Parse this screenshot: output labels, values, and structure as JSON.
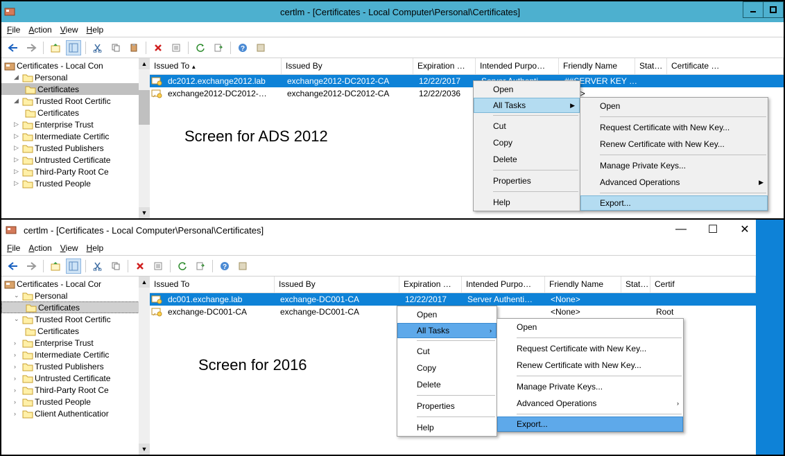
{
  "w2012": {
    "title": "certlm - [Certificates - Local Computer\\Personal\\Certificates]",
    "menu": {
      "file": "File",
      "action": "Action",
      "view": "View",
      "help": "Help"
    },
    "tree": {
      "root": "Certificates - Local Con",
      "personal": "Personal",
      "certs": "Certificates",
      "trusted_root": "Trusted Root Certific",
      "trusted_root_certs": "Certificates",
      "enterprise": "Enterprise Trust",
      "intermediate": "Intermediate Certific",
      "trusted_pub": "Trusted Publishers",
      "untrusted": "Untrusted Certificate",
      "third_party": "Third-Party Root Ce",
      "trusted_people": "Trusted People"
    },
    "cols": {
      "issued_to": "Issued To",
      "issued_by": "Issued By",
      "exp": "Expiration …",
      "purpose": "Intended Purpo…",
      "friendly": "Friendly Name",
      "stat": "Stat…",
      "template": "Certificate …"
    },
    "rows": [
      {
        "issued_to": "dc2012.exchange2012.lab",
        "issued_by": "exchange2012-DC2012-CA",
        "exp": "12/22/2017",
        "purpose": "Server Authenti",
        "friendly": "##SERVER KEY …"
      },
      {
        "issued_to": "exchange2012-DC2012-…",
        "issued_by": "exchange2012-DC2012-CA",
        "exp": "12/22/2036",
        "purpose": "",
        "friendly": "lone>"
      }
    ],
    "ctx1": {
      "open": "Open",
      "all_tasks": "All Tasks",
      "cut": "Cut",
      "copy": "Copy",
      "delete": "Delete",
      "properties": "Properties",
      "help": "Help"
    },
    "ctx2": {
      "open": "Open",
      "req": "Request Certificate with New Key...",
      "renew": "Renew Certificate with New Key...",
      "manage": "Manage Private Keys...",
      "adv": "Advanced Operations",
      "export": "Export..."
    },
    "annotation": "Screen for ADS 2012"
  },
  "w2016": {
    "title": "certlm - [Certificates - Local Computer\\Personal\\Certificates]",
    "menu": {
      "file": "File",
      "action": "Action",
      "view": "View",
      "help": "Help"
    },
    "tree": {
      "root": "Certificates - Local Cor",
      "personal": "Personal",
      "certs": "Certificates",
      "trusted_root": "Trusted Root Certific",
      "trusted_root_certs": "Certificates",
      "enterprise": "Enterprise Trust",
      "intermediate": "Intermediate Certific",
      "trusted_pub": "Trusted Publishers",
      "untrusted": "Untrusted Certificate",
      "third_party": "Third-Party Root Ce",
      "trusted_people": "Trusted People",
      "client_auth": "Client Authenticatior"
    },
    "cols": {
      "issued_to": "Issued To",
      "issued_by": "Issued By",
      "exp": "Expiration …",
      "purpose": "Intended Purpo…",
      "friendly": "Friendly Name",
      "stat": "Stat…",
      "template": "Certif"
    },
    "rows": [
      {
        "issued_to": "dc001.exchange.lab",
        "issued_by": "exchange-DC001-CA",
        "exp": "12/22/2017",
        "purpose": "Server Authenti…",
        "friendly": "<None>"
      },
      {
        "issued_to": "exchange-DC001-CA",
        "issued_by": "exchange-DC001-CA",
        "exp": "",
        "purpose": "",
        "friendly": "<None>",
        "template": "Root"
      }
    ],
    "ctx1": {
      "open": "Open",
      "all_tasks": "All Tasks",
      "cut": "Cut",
      "copy": "Copy",
      "delete": "Delete",
      "properties": "Properties",
      "help": "Help"
    },
    "ctx2": {
      "open": "Open",
      "req": "Request Certificate with New Key...",
      "renew": "Renew Certificate with New Key...",
      "manage": "Manage Private Keys...",
      "adv": "Advanced Operations",
      "export": "Export..."
    },
    "annotation": "Screen for 2016"
  }
}
